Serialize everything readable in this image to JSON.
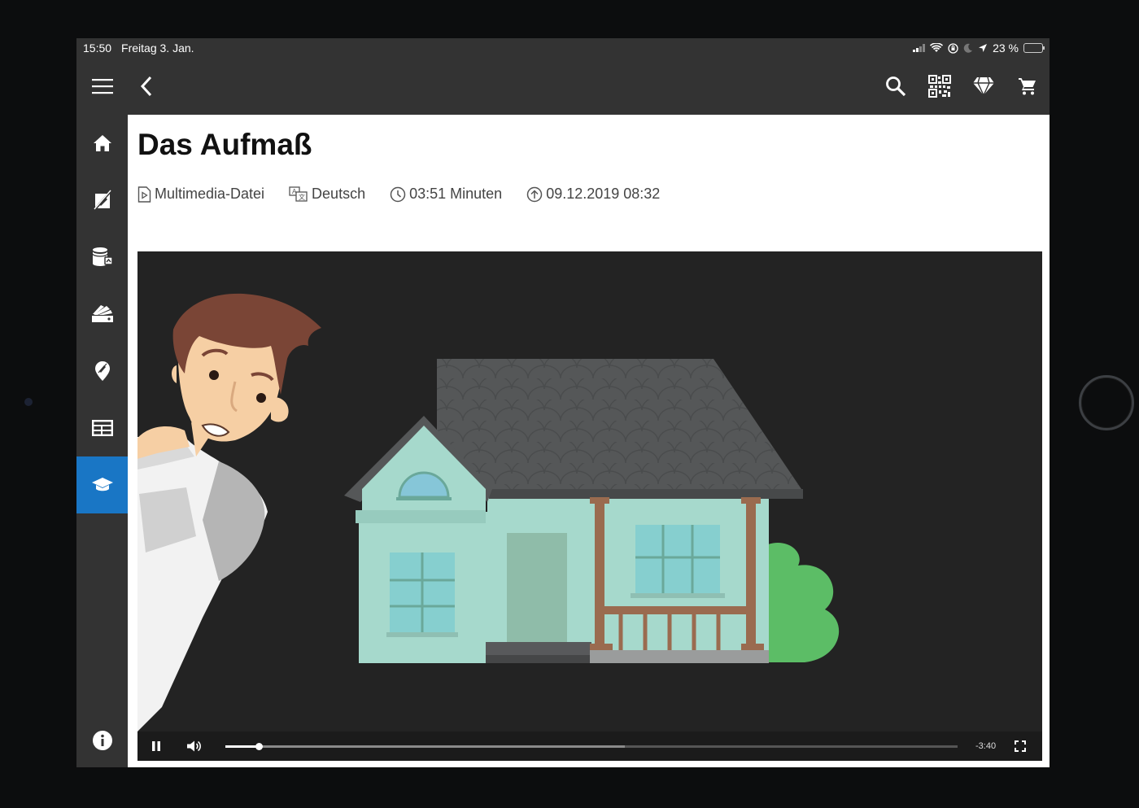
{
  "status_bar": {
    "time": "15:50",
    "date": "Freitag 3. Jan.",
    "battery": "23 %",
    "battery_level": 0.23
  },
  "app_bar": {
    "icons": {
      "menu": "hamburger-menu-icon",
      "back": "chevron-left-icon",
      "search": "search-icon",
      "qr": "qr-code-icon",
      "premium": "diamond-icon",
      "cart": "cart-icon"
    }
  },
  "sidebar": {
    "active_index": 6,
    "items": [
      {
        "id": "home",
        "icon": "home-icon"
      },
      {
        "id": "products",
        "icon": "paint-brush-slash-icon"
      },
      {
        "id": "paint",
        "icon": "paint-bucket-icon"
      },
      {
        "id": "colors",
        "icon": "color-fan-icon"
      },
      {
        "id": "location",
        "icon": "map-pin-icon"
      },
      {
        "id": "catalog",
        "icon": "layout-icon"
      },
      {
        "id": "academy",
        "icon": "graduation-cap-icon"
      },
      {
        "id": "info",
        "icon": "info-icon"
      }
    ]
  },
  "page": {
    "title": "Das Aufmaß",
    "meta": {
      "type": "Multimedia-Datei",
      "language": "Deutsch",
      "duration": "03:51 Minuten",
      "uploaded": "09.12.2019 08:32"
    }
  },
  "video": {
    "state": "playing",
    "remaining": "-3:40",
    "progress": 0.045,
    "buffered": 0.545,
    "colors": {
      "background": "#232323",
      "house_wall": "#a6d9cc",
      "roof": "#555758",
      "bush": "#5cbd66",
      "hair": "#7a4536",
      "skin": "#f6cfa4"
    }
  },
  "colors": {
    "chrome": "#333333",
    "active": "#1976c5"
  }
}
